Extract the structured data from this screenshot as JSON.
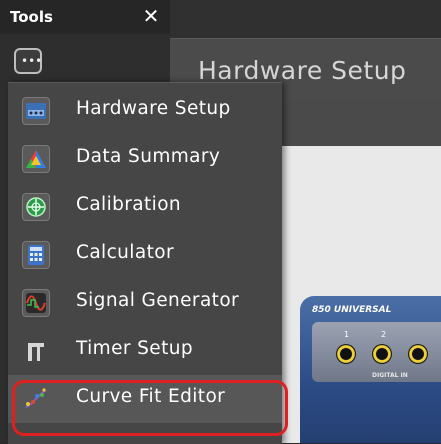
{
  "tools_pane": {
    "title": "Tools",
    "close_glyph": "✕",
    "menu_button_glyph": "•••"
  },
  "main": {
    "tab_title": "Hardware Setup",
    "interface_label": "850 UNIVERSAL",
    "port_numbers": [
      "1",
      "2"
    ],
    "port_caption": "DIGITAL IN"
  },
  "menu": {
    "items": [
      {
        "label": "Hardware Setup",
        "icon": "hardware-setup-icon"
      },
      {
        "label": "Data Summary",
        "icon": "data-summary-icon"
      },
      {
        "label": "Calibration",
        "icon": "calibration-icon"
      },
      {
        "label": "Calculator",
        "icon": "calculator-icon"
      },
      {
        "label": "Signal Generator",
        "icon": "signal-generator-icon"
      },
      {
        "label": "Timer Setup",
        "icon": "timer-setup-icon"
      },
      {
        "label": "Curve Fit Editor",
        "icon": "curve-fit-editor-icon"
      }
    ],
    "highlighted_item": "Curve Fit Editor",
    "highlight_color": "#e02020"
  }
}
